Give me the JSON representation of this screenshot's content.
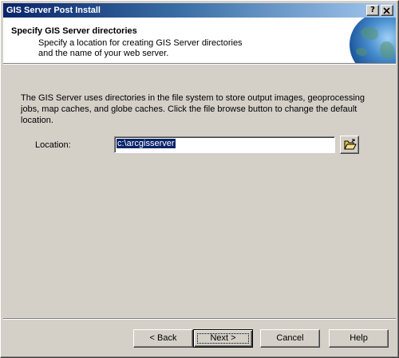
{
  "window": {
    "title": "GIS Server Post Install",
    "help_button": "?",
    "close_button": "X"
  },
  "header": {
    "title": "Specify GIS Server directories",
    "subtitle_line1": "Specify a location for creating GIS Server directories",
    "subtitle_line2": "and the name of your web server."
  },
  "body": {
    "description": "The GIS Server uses directories in the file system to store output images, geoprocessing jobs, map caches, and globe caches.  Click the file browse button to change the default location."
  },
  "location": {
    "label": "Location:",
    "value": "c:\\arcgisserver"
  },
  "buttons": {
    "back": "< Back",
    "next": "Next >",
    "cancel": "Cancel",
    "help": "Help"
  },
  "colors": {
    "titlebar_start": "#0a246a",
    "titlebar_end": "#a6caf0",
    "dialog_face": "#d4d0c8",
    "selection": "#0a246a"
  },
  "icons": {
    "browse": "open-folder-icon",
    "header_logo": "globe-icon"
  }
}
